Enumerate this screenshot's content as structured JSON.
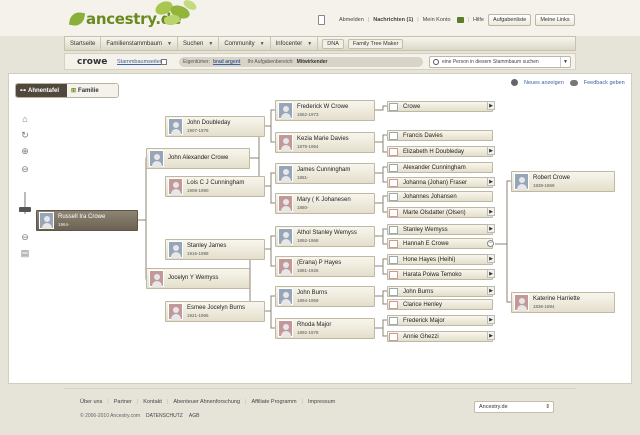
{
  "header": {
    "logo_text": "ancestry.de",
    "links": [
      "Abmelden",
      "Nachrichten (1)",
      "Mein Konto",
      "Hilfe"
    ],
    "buttons": [
      "Aufgabenliste",
      "Meine Links"
    ]
  },
  "nav": {
    "items": [
      "Startseite",
      "Familienstammbaum",
      "Suchen",
      "Community",
      "Infocenter"
    ],
    "buttons": [
      "DNA",
      "Family Tree Maker"
    ]
  },
  "subheader": {
    "person_name": "crowe",
    "tree_pages": "Stammbaumseiten",
    "owner_label": "Eigentümer:",
    "owner_name": "brad argent",
    "role_label": "Ihr Aufgabenbereich:",
    "role_value": "Mitwirkender",
    "search_placeholder": "eine Person in diesem Stammbaum suchen"
  },
  "main": {
    "tabs": {
      "pedigree": "Ahnentafel",
      "family": "Familie"
    },
    "right_links": {
      "new": "Neues anzeigen",
      "feedback": "Feedback geben"
    }
  },
  "tree": {
    "root": {
      "name": "Russell Ira Crowe",
      "dates": "1964-"
    },
    "father": {
      "name": "John Alexander Crowe",
      "dates": ""
    },
    "mother": {
      "name": "Jocelyn Y Wemyss",
      "dates": ""
    },
    "g1": [
      {
        "name": "John Doubleday",
        "dates": "1907-1978"
      },
      {
        "name": "Lois C J Cunningham",
        "dates": "1908-1990"
      },
      {
        "name": "Stanley James",
        "dates": "1916-1988"
      },
      {
        "name": "Esmee Jocelyn Burns",
        "dates": "1921-1966"
      }
    ],
    "g2": [
      {
        "name": "Frederick W Crowe",
        "dates": "1862-1973"
      },
      {
        "name": "Kezia Marie Davies",
        "dates": "1879-1954"
      },
      {
        "name": "James Cunningham",
        "dates": "1881-"
      },
      {
        "name": "Mary ( K Johanesen",
        "dates": "1880-"
      },
      {
        "name": "Athol Stanley Wemyss",
        "dates": "1892-1968"
      },
      {
        "name": "(Erana) P Hayes",
        "dates": "1881-1926"
      },
      {
        "name": "John Burns",
        "dates": "1894-1959"
      },
      {
        "name": "Rhoda Major",
        "dates": "1892-1978"
      }
    ],
    "g3": [
      "Crowe",
      "Francis Davies",
      "Elizabeth H Doubleday",
      "Alexander Cunningham",
      "Johanna (Johan) Fraser",
      "Johannes Johansen",
      "Marte Olsdatter (Olsen)",
      "Stanley Wemyss",
      "Hannah E Crowe",
      "Hone Hayes (Heihi)",
      "Harata Poiwa Temoko",
      "John Burns",
      "Clarice Henley",
      "Frederick Major",
      "Annie Ghezzi"
    ],
    "extra": [
      {
        "name": "Robert Crowe",
        "dates": "1839-1869"
      },
      {
        "name": "Katerine Harriette",
        "dates": "1836-1894"
      }
    ]
  },
  "footer": {
    "links": [
      "Über uns",
      "Partner",
      "Kontakt",
      "Abenteuer Ahnenforschung",
      "Affiliate Programm",
      "Impressum"
    ],
    "copyright": "© 2006-2010 Ancestry.com",
    "legal": [
      "DATENSCHUTZ",
      "AGB"
    ],
    "country": "Ancestry.de"
  }
}
